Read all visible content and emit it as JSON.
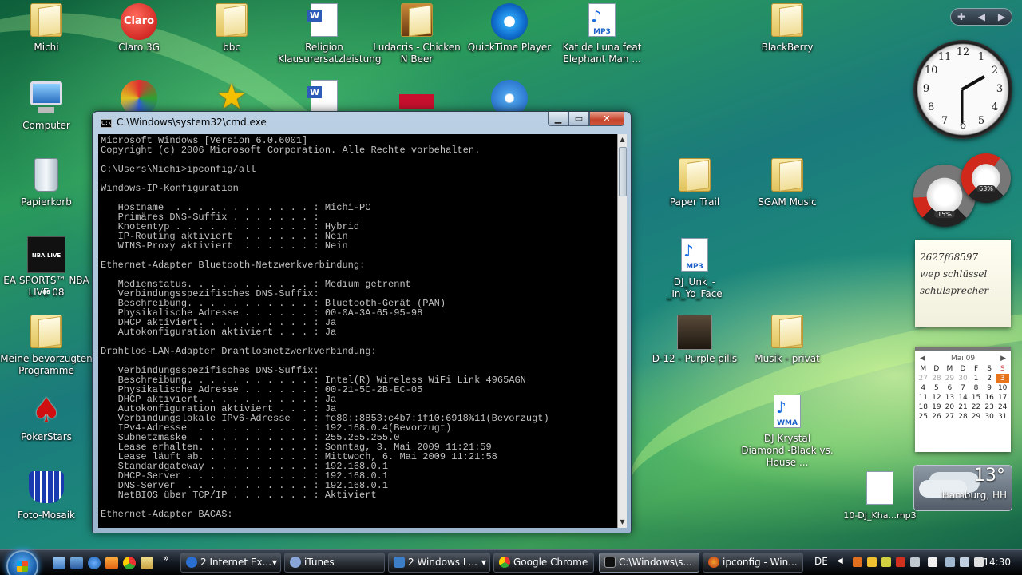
{
  "desktop": {
    "icons": [
      {
        "label": "Michi"
      },
      {
        "label": "Claro 3G",
        "art": "Claro"
      },
      {
        "label": "bbc"
      },
      {
        "label": "Religion Klausurersatzleistung"
      },
      {
        "label": "Ludacris - Chicken N Beer"
      },
      {
        "label": "QuickTime Player"
      },
      {
        "label": "Kat de Luna feat Elephant Man ...",
        "art": "MP3"
      },
      {
        "label": "BlackBerry"
      },
      {
        "label": "Computer"
      },
      {
        "label": "Papierkorb"
      },
      {
        "label": "EA SPORTS™ NBA LIVE 08",
        "art": "NBA LIVE 08"
      },
      {
        "label": "Meine bevorzugten Programme"
      },
      {
        "label": "PokerStars"
      },
      {
        "label": "Foto-Mosaik"
      },
      {
        "label": "Paper Trail"
      },
      {
        "label": "SGAM Music"
      },
      {
        "label": "DJ_Unk_-_In_Yo_Face",
        "art": "MP3"
      },
      {
        "label": "D-12 - Purple pills"
      },
      {
        "label": "Musik - privat"
      },
      {
        "label": "DJ Krystal Diamond -Black vs. House ...",
        "art": "WMA"
      },
      {
        "label": "10-DJ_Kha...mp3"
      }
    ]
  },
  "cmd_window": {
    "title": "C:\\Windows\\system32\\cmd.exe",
    "icon_text": "C:\\",
    "output": "Microsoft Windows [Version 6.0.6001]\nCopyright (c) 2006 Microsoft Corporation. Alle Rechte vorbehalten.\n\nC:\\Users\\Michi>ipconfig/all\n\nWindows-IP-Konfiguration\n\n   Hostname  . . . . . . . . . . . . : Michi-PC\n   Primäres DNS-Suffix . . . . . . . :\n   Knotentyp . . . . . . . . . . . . : Hybrid\n   IP-Routing aktiviert  . . . . . . : Nein\n   WINS-Proxy aktiviert  . . . . . . : Nein\n\nEthernet-Adapter Bluetooth-Netzwerkverbindung:\n\n   Medienstatus. . . . . . . . . . . : Medium getrennt\n   Verbindungsspezifisches DNS-Suffix:\n   Beschreibung. . . . . . . . . . . : Bluetooth-Gerät (PAN)\n   Physikalische Adresse . . . . . . : 00-0A-3A-65-95-98\n   DHCP aktiviert. . . . . . . . . . : Ja\n   Autokonfiguration aktiviert . . . : Ja\n\nDrahtlos-LAN-Adapter Drahtlosnetzwerkverbindung:\n\n   Verbindungsspezifisches DNS-Suffix:\n   Beschreibung. . . . . . . . . . . : Intel(R) Wireless WiFi Link 4965AGN\n   Physikalische Adresse . . . . . . : 00-21-5C-2B-EC-05\n   DHCP aktiviert. . . . . . . . . . : Ja\n   Autokonfiguration aktiviert . . . : Ja\n   Verbindungslokale IPv6-Adresse  . : fe80::8853:c4b7:1f10:6918%11(Bevorzugt)\n   IPv4-Adresse  . . . . . . . . . . : 192.168.0.4(Bevorzugt)\n   Subnetzmaske  . . . . . . . . . . : 255.255.255.0\n   Lease erhalten. . . . . . . . . . : Sonntag, 3. Mai 2009 11:21:59\n   Lease läuft ab. . . . . . . . . . : Mittwoch, 6. Mai 2009 11:21:58\n   Standardgateway . . . . . . . . . : 192.168.0.1\n   DHCP-Server . . . . . . . . . . . : 192.168.0.1\n   DNS-Server  . . . . . . . . . . . : 192.168.0.1\n   NetBIOS über TCP/IP . . . . . . . : Aktiviert\n\nEthernet-Adapter BACAS:"
  },
  "sidebar": {
    "clock_numbers": [
      "12",
      "1",
      "2",
      "3",
      "4",
      "5",
      "6",
      "7",
      "8",
      "9",
      "10",
      "11"
    ],
    "clock_time": "14:30",
    "cpu_meter_percent": 15,
    "ram_meter_percent": 63,
    "cpu_meter_label": "15%",
    "ram_meter_label": "63%",
    "note_lines": [
      "2627f68597",
      "wep schlüssel",
      "schulsprecher-"
    ],
    "calendar": {
      "month": "Mai 09",
      "weekdays": [
        "M",
        "D",
        "M",
        "D",
        "F",
        "S",
        "S"
      ],
      "weeks": [
        [
          "27",
          "28",
          "29",
          "30",
          "1",
          "2",
          "3"
        ],
        [
          "4",
          "5",
          "6",
          "7",
          "8",
          "9",
          "10"
        ],
        [
          "11",
          "12",
          "13",
          "14",
          "15",
          "16",
          "17"
        ],
        [
          "18",
          "19",
          "20",
          "21",
          "22",
          "23",
          "24"
        ],
        [
          "25",
          "26",
          "27",
          "28",
          "29",
          "30",
          "31"
        ]
      ],
      "today": "3"
    },
    "weather": {
      "temp": "13°",
      "city": "Hamburg, HH"
    }
  },
  "taskbar": {
    "buttons": [
      {
        "label": "2 Internet Ex...",
        "dropdown": true,
        "color": "#2a6fd0"
      },
      {
        "label": "iTunes",
        "dropdown": false,
        "color": "#8aa6d8"
      },
      {
        "label": "2 Windows L...",
        "dropdown": true,
        "color": "#3d7ec8"
      },
      {
        "label": "Google Chrome",
        "dropdown": false,
        "color": "#e0a020"
      },
      {
        "label": "C:\\Windows\\s...",
        "dropdown": false,
        "color": "#111111",
        "active": true
      },
      {
        "label": "ipconfig - Win...",
        "dropdown": false,
        "color": "#e06020"
      }
    ],
    "overflow": "»",
    "language": "DE",
    "clock": "14:30"
  }
}
